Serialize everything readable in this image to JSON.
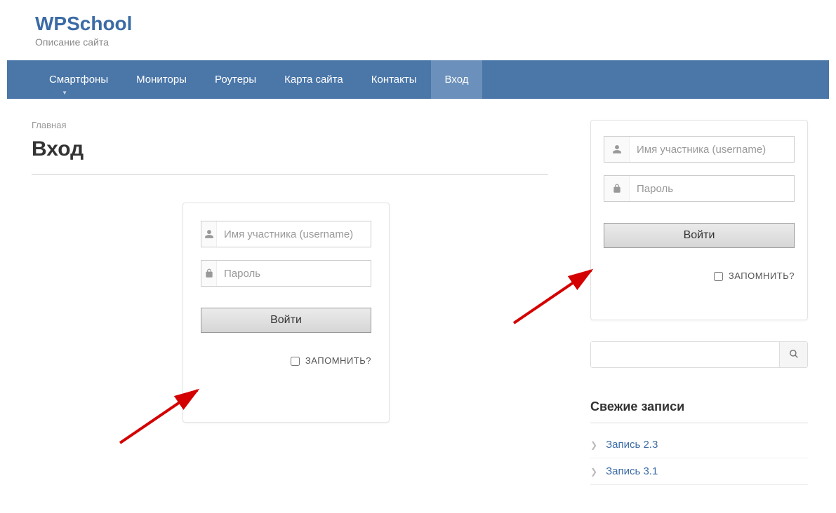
{
  "header": {
    "site_title": "WPSchool",
    "tagline": "Описание сайта"
  },
  "nav": {
    "items": [
      {
        "label": "Смартфоны",
        "has_dropdown": true
      },
      {
        "label": "Мониторы"
      },
      {
        "label": "Роутеры"
      },
      {
        "label": "Карта сайта"
      },
      {
        "label": "Контакты"
      },
      {
        "label": "Вход",
        "active": true
      }
    ]
  },
  "main": {
    "breadcrumb": "Главная",
    "page_title": "Вход",
    "login_form": {
      "username_placeholder": "Имя участника (username)",
      "password_placeholder": "Пароль",
      "submit_label": "Войти",
      "remember_label": "ЗАПОМНИТЬ?"
    }
  },
  "sidebar": {
    "login_form": {
      "username_placeholder": "Имя участника (username)",
      "password_placeholder": "Пароль",
      "submit_label": "Войти",
      "remember_label": "ЗАПОМНИТЬ?"
    },
    "search_placeholder": "",
    "recent_posts": {
      "title": "Свежие записи",
      "items": [
        {
          "label": "Запись 2.3"
        },
        {
          "label": "Запись 3.1"
        }
      ]
    }
  },
  "colors": {
    "accent": "#3b6ba5",
    "nav_bg": "#4a76a8",
    "nav_active": "#6b90bb"
  },
  "annotations": {
    "arrows": [
      "red-arrow-main",
      "red-arrow-sidebar"
    ]
  }
}
